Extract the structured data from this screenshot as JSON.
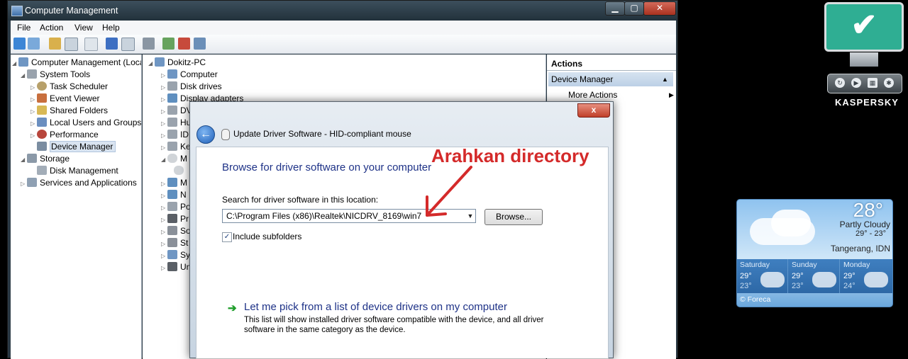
{
  "computer_management": {
    "title": "Computer Management",
    "menu": [
      "File",
      "Action",
      "View",
      "Help"
    ],
    "tree": [
      {
        "label": "Computer Management (Local",
        "icon": "computer-management-icon"
      },
      {
        "label": "System Tools",
        "icon": "system-tools-icon"
      },
      {
        "label": "Task Scheduler",
        "icon": "task-scheduler-icon"
      },
      {
        "label": "Event Viewer",
        "icon": "event-viewer-icon"
      },
      {
        "label": "Shared Folders",
        "icon": "shared-folders-icon"
      },
      {
        "label": "Local Users and Groups",
        "icon": "users-icon"
      },
      {
        "label": "Performance",
        "icon": "performance-icon"
      },
      {
        "label": "Device Manager",
        "icon": "device-manager-icon"
      },
      {
        "label": "Storage",
        "icon": "storage-icon"
      },
      {
        "label": "Disk Management",
        "icon": "disk-management-icon"
      },
      {
        "label": "Services and Applications",
        "icon": "services-icon"
      }
    ],
    "devices": {
      "root": "Dokitz-PC",
      "items": [
        "Computer",
        "Disk drives",
        "Display adapters"
      ],
      "partial": [
        "DV",
        "Hu",
        "ID",
        "Ke",
        "M",
        "",
        "M",
        "N",
        "Po",
        "Pr",
        "So",
        "St",
        "Sy",
        "Un"
      ]
    },
    "actions": {
      "title": "Actions",
      "section": "Device Manager",
      "more": "More Actions"
    }
  },
  "dialog": {
    "close_label": "x",
    "title": "Update Driver Software - HID-compliant mouse",
    "heading": "Browse for driver software on your computer",
    "search_label": "Search for driver software in this location:",
    "path_value": "C:\\Program Files (x86)\\Realtek\\NICDRV_8169\\win7",
    "browse_label": "Browse...",
    "include_subfolders_label": "Include subfolders",
    "include_subfolders_checked": true,
    "pick_title": "Let me pick from a list of device drivers on my computer",
    "pick_desc": "This list will show installed driver software compatible with the device, and all driver software in the same category as the device."
  },
  "annotation": {
    "text": "Arahkan directory",
    "color": "#d42a2a"
  },
  "kaspersky": {
    "logo": "KASPERSKY",
    "status_icon": "check-icon",
    "accent": "#2fae93"
  },
  "weather": {
    "temperature": "28°",
    "condition": "Partly Cloudy",
    "range": "29° - 23°",
    "city": "Tangerang, IDN",
    "forecast": [
      {
        "day": "Saturday",
        "high": "29°",
        "low": "23°"
      },
      {
        "day": "Sunday",
        "high": "29°",
        "low": "23°"
      },
      {
        "day": "Monday",
        "high": "29°",
        "low": "24°"
      }
    ],
    "credit": "© Foreca"
  }
}
